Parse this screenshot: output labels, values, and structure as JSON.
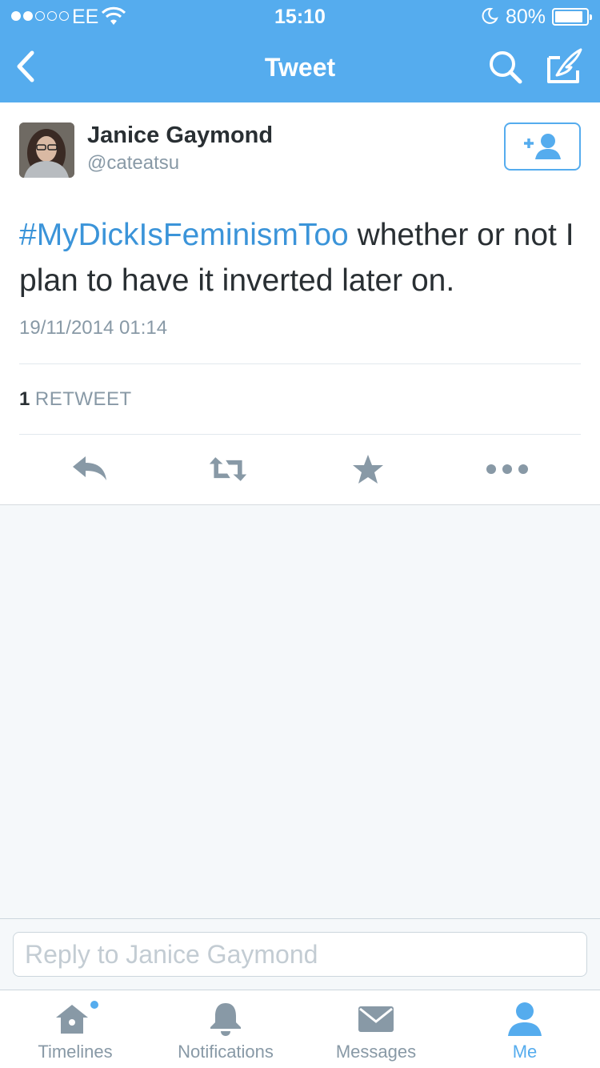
{
  "status_bar": {
    "carrier": "EE",
    "time": "15:10",
    "battery_percent": "80%",
    "battery_level": 0.8,
    "signal_bars_filled": 2,
    "signal_bars_total": 5
  },
  "nav": {
    "title": "Tweet",
    "back_icon": "chevron-left-icon",
    "search_icon": "search-icon",
    "compose_icon": "compose-icon"
  },
  "tweet": {
    "author_name": "Janice Gaymond",
    "author_handle": "@cateatsu",
    "hashtag": "#MyDickIsFeminismToo",
    "text_after_hashtag": " whether or not I plan to have it inverted later on.",
    "timestamp": "19/11/2014 01:14",
    "retweet_count": "1",
    "retweet_label": "RETWEET",
    "actions": [
      "reply-icon",
      "retweet-icon",
      "favorite-icon",
      "more-icon"
    ]
  },
  "reply": {
    "placeholder": "Reply to Janice Gaymond"
  },
  "tabs": [
    {
      "label": "Timelines",
      "icon": "home-icon",
      "has_notification_dot": true
    },
    {
      "label": "Notifications",
      "icon": "bell-icon"
    },
    {
      "label": "Messages",
      "icon": "envelope-icon"
    },
    {
      "label": "Me",
      "icon": "person-icon",
      "active": true
    }
  ],
  "colors": {
    "brand_blue": "#55acee",
    "link_blue": "#3b94d9",
    "text_dark": "#292f33",
    "text_gray": "#8899a6",
    "icon_gray": "#8899a6",
    "background": "#f5f8fa"
  }
}
